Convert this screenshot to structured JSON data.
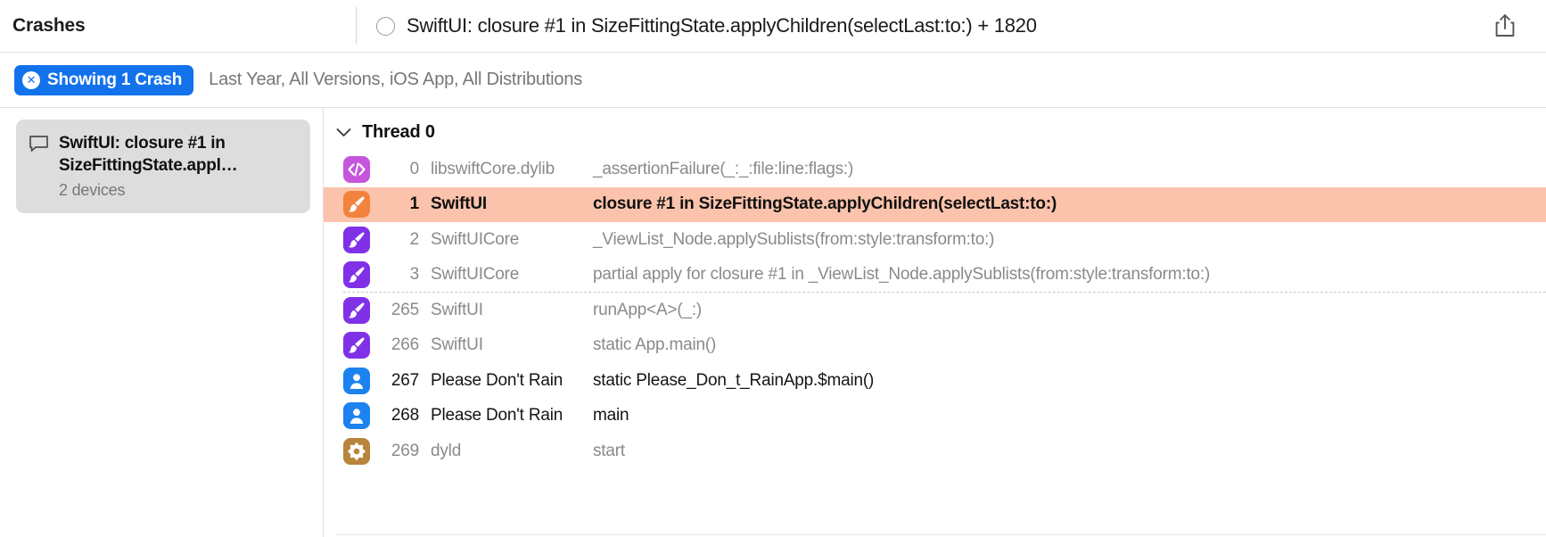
{
  "window": {
    "header": {
      "section_title": "Crashes",
      "crash_title": "SwiftUI: closure #1 in SizeFittingState.applyChildren(selectLast:to:) + 1820",
      "radio_icon": "radio-circle-icon",
      "share_icon": "share-icon"
    },
    "filter_bar": {
      "pill_label": "Showing 1 Crash",
      "pill_close_glyph": "✕",
      "pill_color": "#1272ec",
      "description": "Last Year, All Versions, iOS App, All Distributions"
    }
  },
  "sidebar": {
    "items": [
      {
        "icon": "comment-bubble-icon",
        "title": "SwiftUI: closure #1 in SizeFittingState.appl…",
        "subtitle": "2 devices",
        "selected": true
      }
    ]
  },
  "main": {
    "thread": {
      "disclosure_icon": "chevron-down-icon",
      "label": "Thread 0"
    },
    "columns": [
      "icon",
      "index",
      "binary",
      "symbol"
    ],
    "frames": [
      {
        "index": "0",
        "binary": "libswiftCore.dylib",
        "symbol": "_assertionFailure(_:_:file:line:flags:)",
        "icon": "code-brackets-icon",
        "icon_color": "#c655dd",
        "selected": false,
        "app_code": false,
        "dashed_after": false
      },
      {
        "index": "1",
        "binary": "SwiftUI",
        "symbol": "closure #1 in SizeFittingState.applyChildren(selectLast:to:)",
        "icon": "paintbrush-icon",
        "icon_color": "#f2833f",
        "selected": true,
        "app_code": false,
        "dashed_after": false
      },
      {
        "index": "2",
        "binary": "SwiftUICore",
        "symbol": "_ViewList_Node.applySublists(from:style:transform:to:)",
        "icon": "paintbrush-icon",
        "icon_color": "#8031e8",
        "selected": false,
        "app_code": false,
        "dashed_after": false
      },
      {
        "index": "3",
        "binary": "SwiftUICore",
        "symbol": "partial apply for closure #1 in _ViewList_Node.applySublists(from:style:transform:to:)",
        "icon": "paintbrush-icon",
        "icon_color": "#8031e8",
        "selected": false,
        "app_code": false,
        "dashed_after": true
      },
      {
        "index": "265",
        "binary": "SwiftUI",
        "symbol": "runApp<A>(_:)",
        "icon": "paintbrush-icon",
        "icon_color": "#8031e8",
        "selected": false,
        "app_code": false,
        "dashed_after": false
      },
      {
        "index": "266",
        "binary": "SwiftUI",
        "symbol": "static App.main()",
        "icon": "paintbrush-icon",
        "icon_color": "#8031e8",
        "selected": false,
        "app_code": false,
        "dashed_after": false
      },
      {
        "index": "267",
        "binary": "Please Don't Rain",
        "symbol": "static Please_Don_t_RainApp.$main()",
        "icon": "person-icon",
        "icon_color": "#1b82f0",
        "selected": false,
        "app_code": true,
        "dashed_after": false
      },
      {
        "index": "268",
        "binary": "Please Don't Rain",
        "symbol": "main",
        "icon": "person-icon",
        "icon_color": "#1b82f0",
        "selected": false,
        "app_code": true,
        "dashed_after": false
      },
      {
        "index": "269",
        "binary": "dyld",
        "symbol": "start",
        "icon": "gear-icon",
        "icon_color": "#b8853c",
        "selected": false,
        "app_code": false,
        "dashed_after": false
      }
    ]
  }
}
